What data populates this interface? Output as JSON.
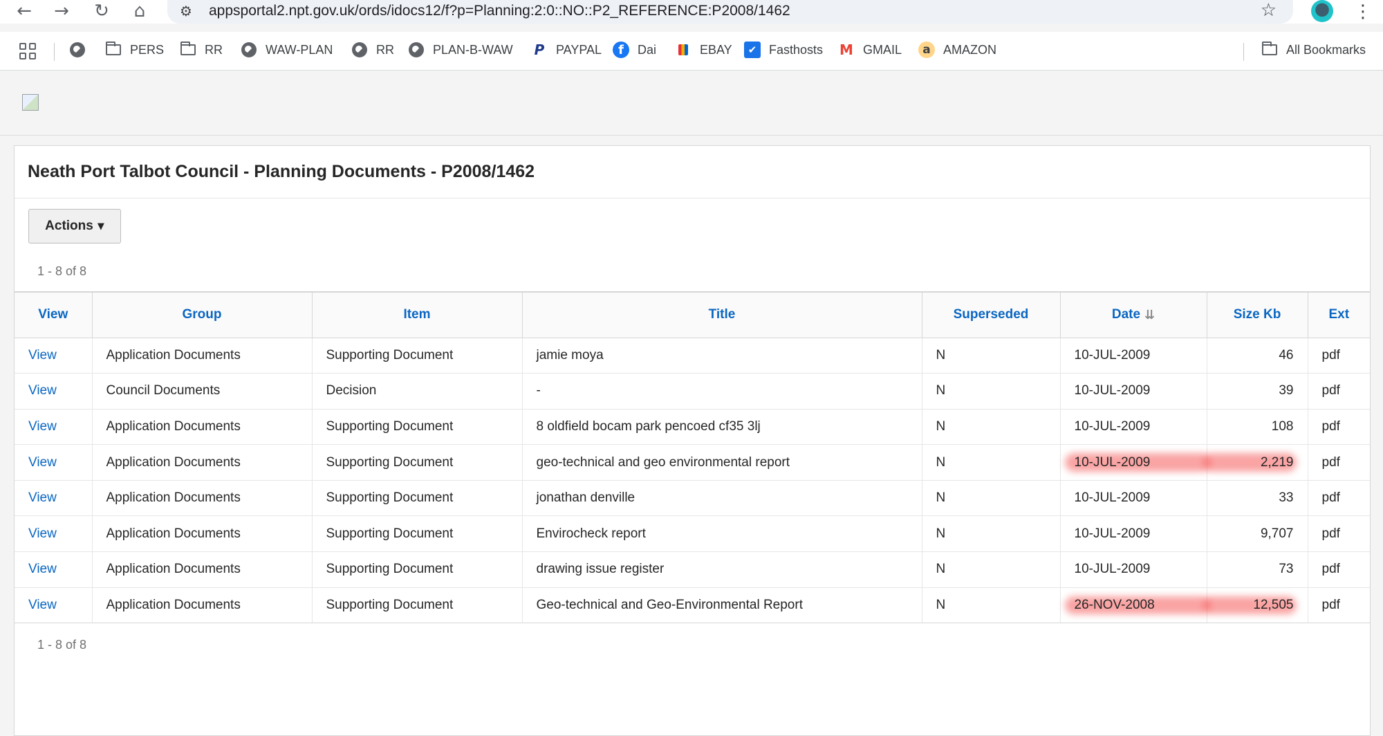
{
  "browser": {
    "url": "appsportal2.npt.gov.uk/ords/idocs12/f?p=Planning:2:0::NO::P2_REFERENCE:P2008/1462",
    "bookmarks": [
      {
        "label": "",
        "icon": "globe-icon"
      },
      {
        "label": "PERS",
        "icon": "folder-icon"
      },
      {
        "label": "RR",
        "icon": "folder-icon"
      },
      {
        "label": "WAW-PLAN",
        "icon": "globe-icon"
      },
      {
        "label": "RR",
        "icon": "globe-icon"
      },
      {
        "label": "PLAN-B-WAW",
        "icon": "globe-icon"
      },
      {
        "label": "PAYPAL",
        "icon": "paypal-icon"
      },
      {
        "label": "Dai",
        "icon": "facebook-icon"
      },
      {
        "label": "EBAY",
        "icon": "ebay-icon"
      },
      {
        "label": "Fasthosts",
        "icon": "fasthosts-icon"
      },
      {
        "label": "GMAIL",
        "icon": "gmail-icon"
      },
      {
        "label": "AMAZON",
        "icon": "amazon-icon"
      }
    ],
    "all_bookmarks": "All Bookmarks"
  },
  "region": {
    "title": "Neath Port Talbot Council - Planning Documents - P2008/1462",
    "actions_label": "Actions",
    "pagination_top": "1 - 8 of 8",
    "pagination_bottom": "1 - 8 of 8"
  },
  "table": {
    "columns": [
      "View",
      "Group",
      "Item",
      "Title",
      "Superseded",
      "Date",
      "Size Kb",
      "Ext"
    ],
    "rows": [
      {
        "view": "View",
        "group": "Application Documents",
        "item": "Supporting Document",
        "title": "jamie moya",
        "superseded": "N",
        "date": "10-JUL-2009",
        "size": "46",
        "ext": "pdf",
        "highlight": false
      },
      {
        "view": "View",
        "group": "Council Documents",
        "item": "Decision",
        "title": "-",
        "superseded": "N",
        "date": "10-JUL-2009",
        "size": "39",
        "ext": "pdf",
        "highlight": false
      },
      {
        "view": "View",
        "group": "Application Documents",
        "item": "Supporting Document",
        "title": "8 oldfield bocam park pencoed cf35 3lj",
        "superseded": "N",
        "date": "10-JUL-2009",
        "size": "108",
        "ext": "pdf",
        "highlight": false
      },
      {
        "view": "View",
        "group": "Application Documents",
        "item": "Supporting Document",
        "title": "geo-technical and geo environmental report",
        "superseded": "N",
        "date": "10-JUL-2009",
        "size": "2,219",
        "ext": "pdf",
        "highlight": true
      },
      {
        "view": "View",
        "group": "Application Documents",
        "item": "Supporting Document",
        "title": "jonathan denville",
        "superseded": "N",
        "date": "10-JUL-2009",
        "size": "33",
        "ext": "pdf",
        "highlight": false
      },
      {
        "view": "View",
        "group": "Application Documents",
        "item": "Supporting Document",
        "title": "Envirocheck report",
        "superseded": "N",
        "date": "10-JUL-2009",
        "size": "9,707",
        "ext": "pdf",
        "highlight": false
      },
      {
        "view": "View",
        "group": "Application Documents",
        "item": "Supporting Document",
        "title": "drawing issue register",
        "superseded": "N",
        "date": "10-JUL-2009",
        "size": "73",
        "ext": "pdf",
        "highlight": false
      },
      {
        "view": "View",
        "group": "Application Documents",
        "item": "Supporting Document",
        "title": "Geo-technical and Geo-Environmental Report",
        "superseded": "N",
        "date": "26-NOV-2008",
        "size": "12,505",
        "ext": "pdf",
        "highlight": true
      }
    ]
  },
  "colors": {
    "link": "#0a66c2",
    "highlight": "#f55a5a"
  }
}
